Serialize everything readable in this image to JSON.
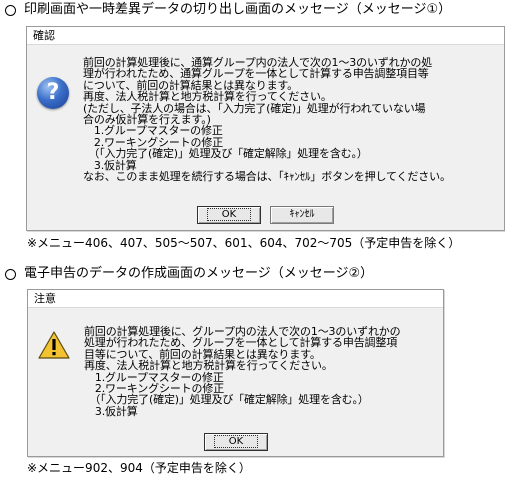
{
  "section1": {
    "heading": "印刷画面や一時差異データの切り出し画面のメッセージ（メッセージ①）",
    "dialog": {
      "title": "確認",
      "icon": "question-icon",
      "message_lines": [
        "前回の計算処理後に、通算グループ内の法人で次の1～3のいずれかの処",
        "理が行われたため、通算グループを一体として計算する申告調整項目等",
        "について、前回の計算結果とは異なります。",
        "再度、法人税計算と地方税計算を行ってください。",
        "(ただし、子法人の場合は、「入力完了(確定)」処理が行われていない場",
        "合のみ仮計算を行えます。)",
        "　1.グループマスターの修正",
        "　2.ワーキングシートの修正",
        "　（「入力完了(確定)」処理及び「確定解除」処理を含む。）",
        "　3.仮計算",
        "なお、このまま処理を続行する場合は、「ｷｬﾝｾﾙ」ボタンを押してください。"
      ],
      "ok_label": "OK",
      "cancel_label": "ｷｬﾝｾﾙ"
    },
    "note": "※メニュー406、407、505～507、601、604、702～705（予定申告を除く）"
  },
  "section2": {
    "heading": "電子申告のデータの作成画面のメッセージ（メッセージ②）",
    "dialog": {
      "title": "注意",
      "icon": "warning-icon",
      "message_lines": [
        "前回の計算処理後に、グループ内の法人で次の1～3のいずれかの",
        "処理が行われたため、グループを一体として計算する申告調整項",
        "目等について、前回の計算結果とは異なります。",
        "再度、法人税計算と地方税計算を行ってください。",
        "　1.グループマスターの修正",
        "　2.ワーキングシートの修正",
        "　（「入力完了(確定)」処理及び「確定解除」処理を含む。）",
        "　3.仮計算"
      ],
      "ok_label": "OK"
    },
    "note": "※メニュー902、904（予定申告を除く）"
  }
}
